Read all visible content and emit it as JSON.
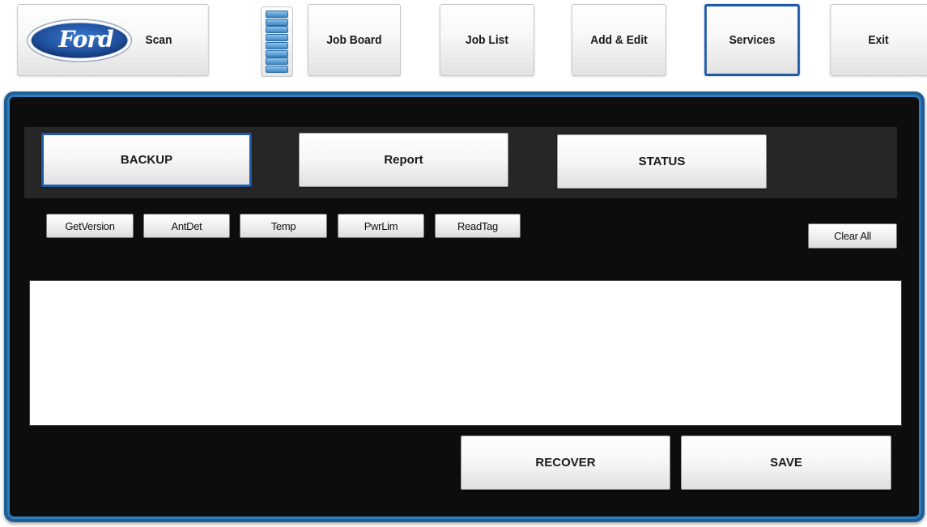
{
  "nav": {
    "brand_logo_text": "Ford",
    "scan_label": "Scan",
    "stack_icon": "stacked-list-icon",
    "job_board_label": "Job Board",
    "job_list_label": "Job List",
    "add_edit_label": "Add & Edit",
    "services_label": "Services",
    "exit_label": "Exit",
    "active_item": "Services"
  },
  "tabs": {
    "backup_label": "BACKUP",
    "report_label": "Report",
    "status_label": "STATUS",
    "active_tab": "BACKUP"
  },
  "commands": {
    "get_version_label": "GetVersion",
    "ant_det_label": "AntDet",
    "temp_label": "Temp",
    "pwr_lim_label": "PwrLim",
    "read_tag_label": "ReadTag",
    "clear_all_label": "Clear All"
  },
  "output": {
    "text": ""
  },
  "actions": {
    "recover_label": "RECOVER",
    "save_label": "SAVE"
  },
  "colors": {
    "accent_blue": "#1e5aa8",
    "frame_blue": "#1f5f96",
    "panel_bg": "#0d0d0d",
    "tab_strip_bg": "#262626",
    "ford_oval": "#1f4f9c"
  }
}
